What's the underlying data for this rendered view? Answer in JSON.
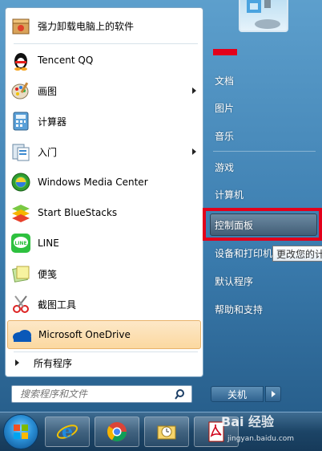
{
  "left_panel": {
    "programs": [
      {
        "label": "强力卸载电脑上的软件",
        "icon": "uninstall-box-icon",
        "submenu": false
      },
      {
        "label": "Tencent QQ",
        "icon": "qq-penguin-icon",
        "submenu": false
      },
      {
        "label": "画图",
        "icon": "paint-palette-icon",
        "submenu": true
      },
      {
        "label": "计算器",
        "icon": "calculator-icon",
        "submenu": false
      },
      {
        "label": "入门",
        "icon": "getting-started-icon",
        "submenu": true
      },
      {
        "label": "Windows Media Center",
        "icon": "media-center-icon",
        "submenu": false
      },
      {
        "label": "Start BlueStacks",
        "icon": "bluestacks-icon",
        "submenu": false
      },
      {
        "label": "LINE",
        "icon": "line-icon",
        "submenu": false
      },
      {
        "label": "便笺",
        "icon": "sticky-notes-icon",
        "submenu": false
      },
      {
        "label": "截图工具",
        "icon": "snipping-tool-icon",
        "submenu": false
      },
      {
        "label": "Microsoft OneDrive",
        "icon": "onedrive-cloud-icon",
        "submenu": false
      }
    ],
    "all_programs_label": "所有程序",
    "search_placeholder": "搜索程序和文件"
  },
  "right_panel": {
    "items": [
      {
        "label": "文档"
      },
      {
        "label": "图片"
      },
      {
        "label": "音乐"
      },
      {
        "label": "游戏"
      },
      {
        "label": "计算机"
      },
      {
        "label": "控制面板"
      },
      {
        "label": "设备和打印机"
      },
      {
        "label": "默认程序"
      },
      {
        "label": "帮助和支持"
      }
    ],
    "tooltip": "更改您的计",
    "shutdown_label": "关机"
  },
  "taskbar": {
    "apps": [
      "internet-explorer-icon",
      "chrome-icon",
      "outlook-icon",
      "pdf-icon"
    ]
  },
  "watermark": {
    "brand": "Bai 经验",
    "url": "jingyan.baidu.com"
  },
  "colors": {
    "highlight_box": "#e3001b",
    "menu_glass": "#3c7daf",
    "hover_orange": "#fbd8a0"
  }
}
